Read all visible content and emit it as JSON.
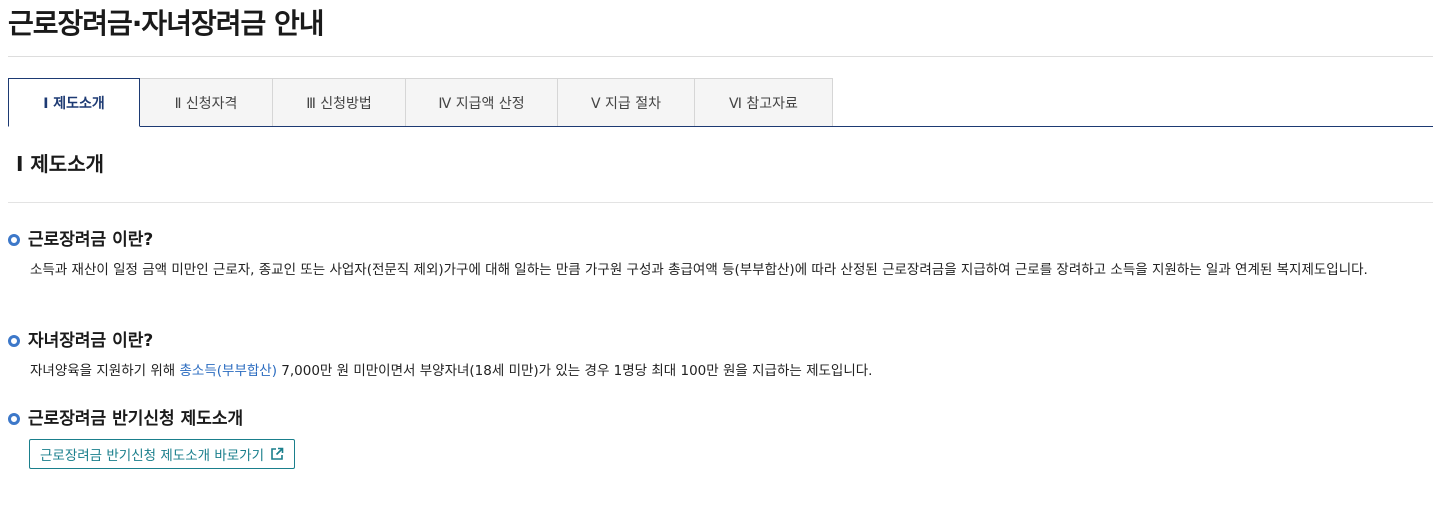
{
  "page": {
    "title": "근로장려금·자녀장려금 안내"
  },
  "tabs": [
    {
      "label": "Ⅰ  제도소개"
    },
    {
      "label": "Ⅱ  신청자격"
    },
    {
      "label": "Ⅲ  신청방법"
    },
    {
      "label": "Ⅳ  지급액 산정"
    },
    {
      "label": "Ⅴ  지급 절차"
    },
    {
      "label": "Ⅵ  참고자료"
    }
  ],
  "section": {
    "title": "Ⅰ 제도소개"
  },
  "items": [
    {
      "heading": "근로장려금 이란?",
      "desc": "소득과 재산이 일정 금액 미만인 근로자, 종교인 또는 사업자(전문직 제외)가구에 대해 일하는 만큼 가구원 구성과 총급여액 등(부부합산)에 따라 산정된 근로장려금을 지급하여 근로를 장려하고 소득을 지원하는 일과 연계된 복지제도입니다."
    },
    {
      "heading": "자녀장려금 이란?",
      "desc_before": "자녀양육을 지원하기 위해 ",
      "desc_link": "총소득(부부합산)",
      "desc_after": " 7,000만 원 미만이면서 부양자녀(18세 미만)가 있는 경우 1명당 최대 100만 원을 지급하는 제도입니다."
    },
    {
      "heading": "근로장려금 반기신청 제도소개",
      "button_label": "근로장려금 반기신청 제도소개 바로가기"
    }
  ],
  "colors": {
    "accent": "#1d3a73",
    "bullet": "#3d78c9",
    "link": "#2b6cc0",
    "button": "#1a7f8c"
  },
  "icons": {
    "bullet": "circle-bullet-icon",
    "external": "external-link-icon"
  }
}
